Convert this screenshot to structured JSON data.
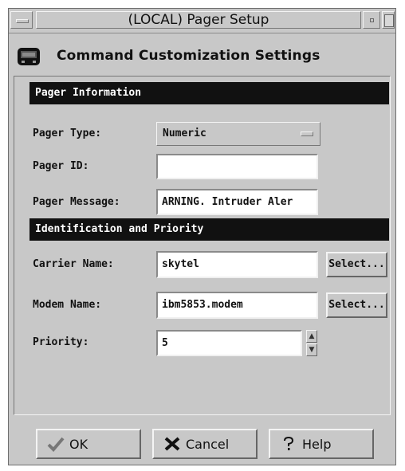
{
  "window": {
    "title": "(LOCAL) Pager Setup"
  },
  "header": {
    "title": "Command Customization Settings",
    "icon": "pager-icon"
  },
  "sections": {
    "pager_info": {
      "title": "Pager Information",
      "pager_type": {
        "label": "Pager Type:",
        "value": "Numeric"
      },
      "pager_id": {
        "label": "Pager ID:",
        "value": ""
      },
      "pager_message": {
        "label": "Pager Message:",
        "value": "ARNING. Intruder Aler"
      }
    },
    "identification": {
      "title": "Identification and Priority",
      "carrier_name": {
        "label": "Carrier Name:",
        "value": "skytel",
        "select_label": "Select..."
      },
      "modem_name": {
        "label": "Modem Name:",
        "value": "ibm5853.modem",
        "select_label": "Select..."
      },
      "priority": {
        "label": "Priority:",
        "value": "5"
      }
    }
  },
  "buttons": {
    "ok": {
      "label": "OK",
      "icon": "checkmark-icon"
    },
    "cancel": {
      "label": "Cancel",
      "icon": "x-icon"
    },
    "help": {
      "label": "Help",
      "icon": "question-icon"
    }
  },
  "colors": {
    "window_bg": "#c8c8c8",
    "section_bar": "#111111"
  }
}
